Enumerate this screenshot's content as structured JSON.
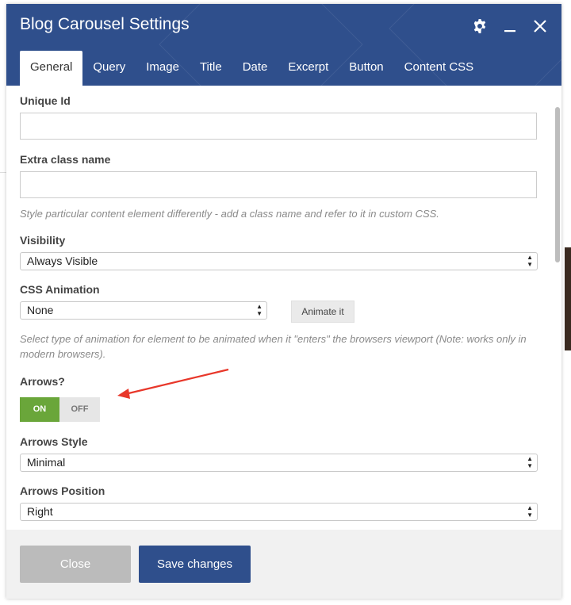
{
  "modal": {
    "title": "Blog Carousel Settings",
    "header_color": "#2f4f8c",
    "icons": [
      "gear-icon",
      "minimize-icon",
      "close-icon"
    ]
  },
  "tabs": [
    {
      "label": "General",
      "active": true
    },
    {
      "label": "Query"
    },
    {
      "label": "Image"
    },
    {
      "label": "Title"
    },
    {
      "label": "Date"
    },
    {
      "label": "Excerpt"
    },
    {
      "label": "Button"
    },
    {
      "label": "Content CSS"
    }
  ],
  "fields": {
    "unique_id": {
      "label": "Unique Id",
      "value": ""
    },
    "extra_class": {
      "label": "Extra class name",
      "value": "",
      "help": "Style particular content element differently - add a class name and refer to it in custom CSS."
    },
    "visibility": {
      "label": "Visibility",
      "selected": "Always Visible"
    },
    "css_animation": {
      "label": "CSS Animation",
      "selected": "None",
      "button": "Animate it",
      "help": "Select type of animation for element to be animated when it \"enters\" the browsers viewport (Note: works only in modern browsers)."
    },
    "arrows": {
      "label": "Arrows?",
      "on_label": "ON",
      "off_label": "OFF",
      "state": "on",
      "on_color": "#6aa63a"
    },
    "arrows_style": {
      "label": "Arrows Style",
      "selected": "Minimal"
    },
    "arrows_position": {
      "label": "Arrows Position",
      "selected": "Right"
    }
  },
  "footer": {
    "close_label": "Close",
    "save_label": "Save changes"
  },
  "annotation": {
    "arrow_color": "#e8372a"
  }
}
